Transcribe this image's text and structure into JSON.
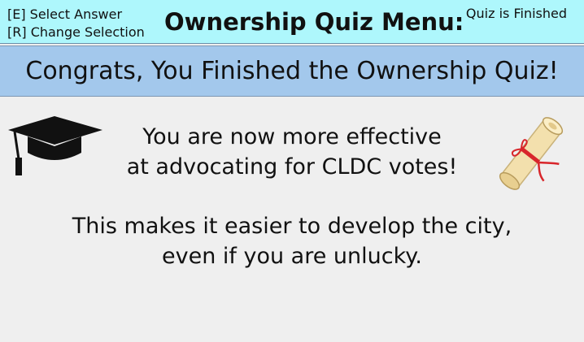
{
  "header": {
    "controls": [
      "[E] Select Answer",
      "[R] Change Selection"
    ],
    "title": "Ownership Quiz Menu:",
    "status": "Quiz is Finished"
  },
  "banner": {
    "text": "Congrats, You Finished the Ownership Quiz!"
  },
  "body": {
    "message1": [
      "You are now more effective",
      "at advocating for CLDC votes!"
    ],
    "message2": [
      "This makes it easier to develop the city,",
      "even if you are unlucky."
    ]
  },
  "icons": {
    "left": "graduation-cap-icon",
    "right": "diploma-scroll-icon"
  },
  "colors": {
    "header_bg": "#aef7fc",
    "banner_bg": "#a3c8ec",
    "body_bg": "#efefef",
    "scroll_paper": "#f3e0ad",
    "ribbon": "#d8262b"
  }
}
